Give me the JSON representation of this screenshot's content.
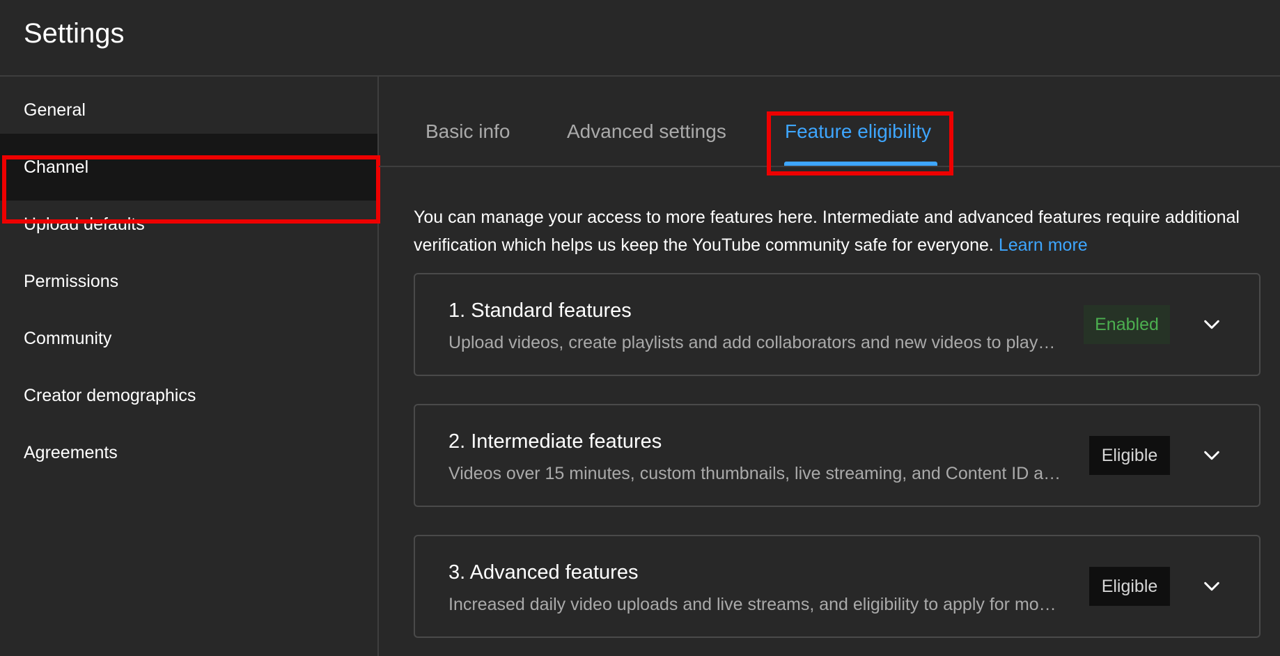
{
  "header": {
    "title": "Settings"
  },
  "sidebar": {
    "items": [
      {
        "label": "General"
      },
      {
        "label": "Channel"
      },
      {
        "label": "Upload defaults"
      },
      {
        "label": "Permissions"
      },
      {
        "label": "Community"
      },
      {
        "label": "Creator demographics"
      },
      {
        "label": "Agreements"
      }
    ],
    "active": "Channel"
  },
  "tabs": {
    "items": [
      {
        "label": "Basic info"
      },
      {
        "label": "Advanced settings"
      },
      {
        "label": "Feature eligibility"
      }
    ],
    "active": "Feature eligibility"
  },
  "intro": {
    "text": "You can manage your access to more features here. Intermediate and advanced features require additional verification which helps us keep the YouTube community safe for everyone.",
    "link": "Learn more"
  },
  "features": [
    {
      "title": "1. Standard features",
      "description": "Upload videos, create playlists and add collaborators and new videos to play…",
      "status": "Enabled"
    },
    {
      "title": "2. Intermediate features",
      "description": "Videos over 15 minutes, custom thumbnails, live streaming, and Content ID a…",
      "status": "Eligible"
    },
    {
      "title": "3. Advanced features",
      "description": "Increased daily video uploads and live streams, and eligibility to apply for mo…",
      "status": "Eligible"
    }
  ],
  "colors": {
    "background": "#282828",
    "accent": "#3ea6ff",
    "highlight": "#ee0000",
    "enabled_text": "#4caf50",
    "enabled_bg": "#263326",
    "eligible_bg": "#0f0f0f"
  },
  "icons": {
    "card_expand": "chevron-down-icon"
  }
}
